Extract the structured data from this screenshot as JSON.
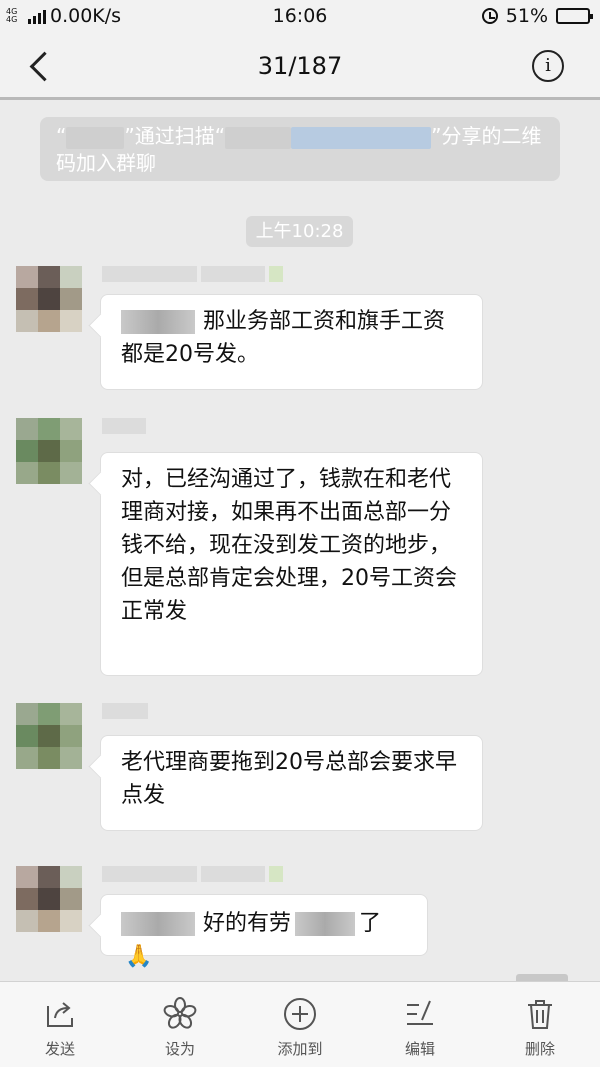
{
  "status_bar": {
    "network_type": "4G 4G",
    "speed": "0.00K/s",
    "time": "16:06",
    "battery": "51%",
    "battery_level": 0.51
  },
  "nav": {
    "title": "31/187",
    "info_glyph": "i"
  },
  "system_message": {
    "part1": "“",
    "part2": "”通过扫描“",
    "part3": "”分享的二维码加入群聊"
  },
  "timestamp": "上午10:28",
  "messages": [
    {
      "text": "那业务部工资和旗手工资都是20号发。"
    },
    {
      "text": "对，已经沟通过了，钱款在和老代理商对接，如果再不出面总部一分钱不给，现在没到发工资的地步，但是总部肯定会处理，20号工资会正常发"
    },
    {
      "text": "老代理商要拖到20号总部会要求早点发"
    },
    {
      "text_a": "好的有劳",
      "text_b": "了",
      "emoji": "🙏"
    }
  ],
  "toolbar": {
    "items": [
      {
        "label": "发送",
        "icon": "share-icon"
      },
      {
        "label": "设为",
        "icon": "flower-icon"
      },
      {
        "label": "添加到",
        "icon": "plus-circle-icon"
      },
      {
        "label": "编辑",
        "icon": "edit-icon"
      },
      {
        "label": "删除",
        "icon": "trash-icon"
      }
    ]
  },
  "colors": {
    "background": "#ebebeb",
    "bubble": "#ffffff",
    "pill": "#d8d8d8",
    "toolbar": "#f7f7f7"
  }
}
